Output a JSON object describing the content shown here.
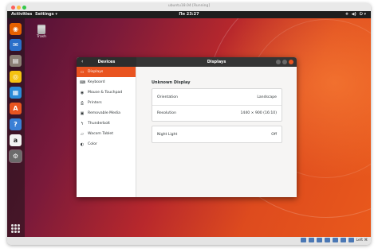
{
  "vm": {
    "title": "ubuntu18.04 [Running]"
  },
  "topbar": {
    "activities": "Activities",
    "app_menu": "Settings ▾",
    "clock": "Пн 23:27",
    "tray": [
      "⟡",
      "◀)",
      "⏻ ▾"
    ]
  },
  "desktop": {
    "trash_label": "Trash"
  },
  "dock": {
    "items": [
      {
        "name": "firefox-icon",
        "bg": "#e66000",
        "glyph": "◉"
      },
      {
        "name": "thunderbird-icon",
        "bg": "#2a6fc9",
        "glyph": "✉"
      },
      {
        "name": "files-icon",
        "bg": "#8a7e74",
        "glyph": "▤"
      },
      {
        "name": "rhythmbox-icon",
        "bg": "#f5c211",
        "glyph": "◎"
      },
      {
        "name": "writer-icon",
        "bg": "#2a8bd8",
        "glyph": "▦"
      },
      {
        "name": "software-icon",
        "bg": "#e95420",
        "glyph": "A"
      },
      {
        "name": "help-icon",
        "bg": "#3a7fd5",
        "glyph": "?"
      },
      {
        "name": "amazon-icon",
        "bg": "#f2f2f2",
        "glyph": "a"
      },
      {
        "name": "settings-icon",
        "bg": "#6b6b6b",
        "glyph": "⚙"
      }
    ]
  },
  "settings": {
    "left_title": "Devices",
    "right_title": "Displays",
    "sidebar": [
      {
        "label": "Displays",
        "icon": "▭",
        "icon_name": "display-icon",
        "selected": true
      },
      {
        "label": "Keyboard",
        "icon": "⌨",
        "icon_name": "keyboard-icon"
      },
      {
        "label": "Mouse & Touchpad",
        "icon": "◉",
        "icon_name": "mouse-icon"
      },
      {
        "label": "Printers",
        "icon": "⎙",
        "icon_name": "printer-icon"
      },
      {
        "label": "Removable Media",
        "icon": "▣",
        "icon_name": "media-icon"
      },
      {
        "label": "Thunderbolt",
        "icon": "ϟ",
        "icon_name": "thunderbolt-icon"
      },
      {
        "label": "Wacom Tablet",
        "icon": "▱",
        "icon_name": "tablet-icon"
      },
      {
        "label": "Color",
        "icon": "◐",
        "icon_name": "color-icon"
      }
    ],
    "section_title": "Unknown Display",
    "orientation_label": "Orientation",
    "orientation_value": "Landscape",
    "resolution_label": "Resolution",
    "resolution_value": "1440 × 900 (16:10)",
    "night_light_label": "Night Light",
    "night_light_value": "Off"
  },
  "colors": {
    "accent": "#e95420",
    "close": "#e95420"
  },
  "statusbar": {
    "right_text": "Left ⌘"
  }
}
